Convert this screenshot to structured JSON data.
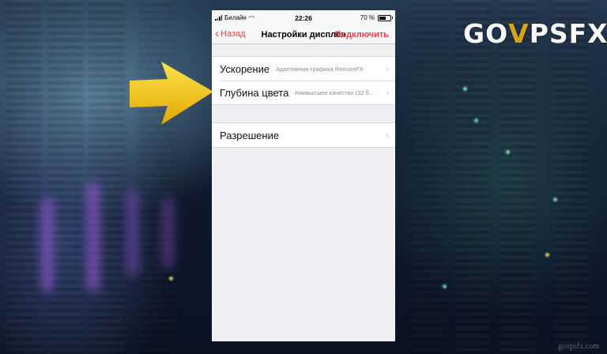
{
  "status_bar": {
    "carrier": "Билайн",
    "time": "22:26",
    "battery_text": "70 %",
    "battery_level": 0.7
  },
  "nav": {
    "back_label": "Назад",
    "title": "Настройки дисплея",
    "action_label": "Подключить"
  },
  "settings_groups": [
    {
      "rows": [
        {
          "label": "Ускорение",
          "detail": "Адаптивная графика RemoteFX"
        },
        {
          "label": "Глубина цвета",
          "detail": "Наивысшее качество (32 б..."
        }
      ]
    },
    {
      "rows": [
        {
          "label": "Разрешение",
          "detail": ""
        }
      ]
    }
  ],
  "branding": {
    "logo_part1": "GO",
    "logo_part2": "V",
    "logo_part3": "PSFX",
    "watermark": "govpsfx.com"
  },
  "colors": {
    "accent": "#e8414a",
    "arrow": "#f5c400",
    "logo_accent": "#d4a21b"
  }
}
